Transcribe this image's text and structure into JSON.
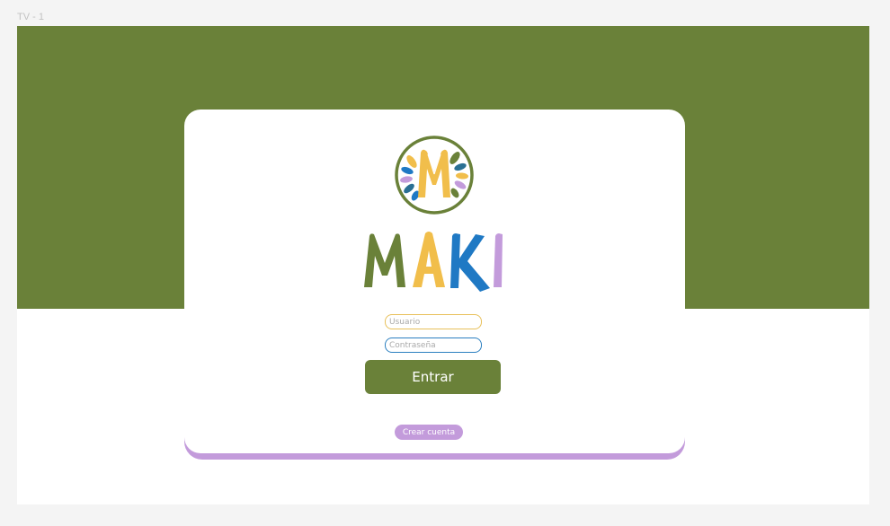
{
  "frame": {
    "label": "TV - 1"
  },
  "brand": {
    "name_letters": [
      "M",
      "A",
      "K",
      "I"
    ],
    "logo_letter": "M",
    "colors": {
      "green": "#6a8139",
      "yellow": "#f1be4b",
      "blue": "#1f79c4",
      "purple": "#c39bdb",
      "teal": "#2a6f93"
    }
  },
  "login": {
    "username_placeholder": "Usuario",
    "password_placeholder": "Contraseña",
    "enter_label": "Entrar",
    "create_account_label": "Crear cuenta"
  }
}
